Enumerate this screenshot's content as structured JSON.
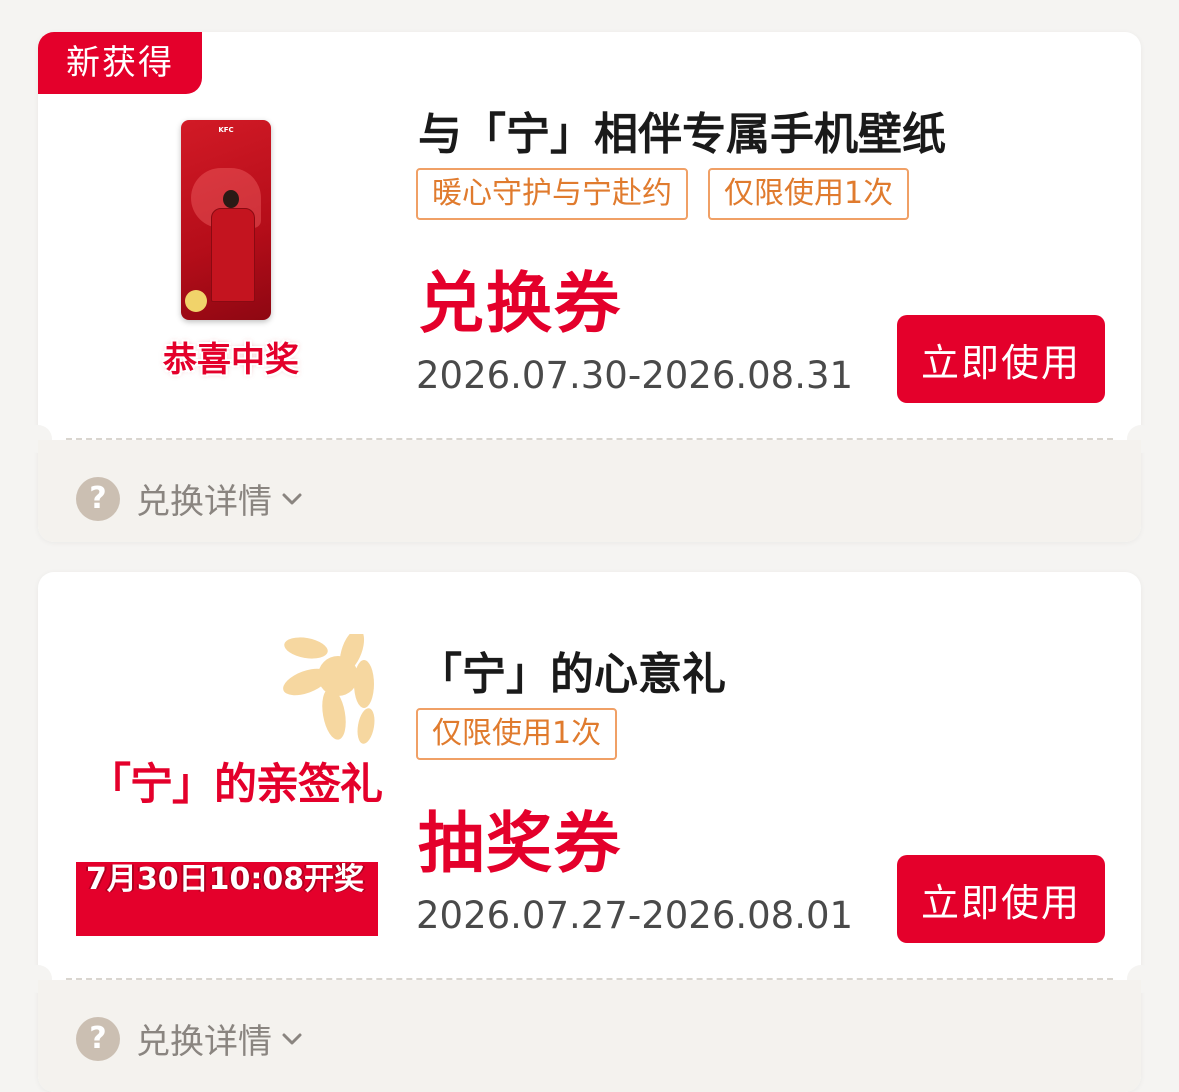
{
  "coupons": [
    {
      "badge": "新获得",
      "title": "与「宁」相伴专属手机壁纸",
      "tags": [
        "暖心守护与宁赴约",
        "仅限使用1次"
      ],
      "type": "兑换券",
      "date_range": "2026.07.30-2026.08.31",
      "use_button": "立即使用",
      "details_label": "兑换详情",
      "thumbnail": {
        "brand": "KFC",
        "caption": "恭喜中奖"
      }
    },
    {
      "title": "「宁」的心意礼",
      "tags": [
        "仅限使用1次"
      ],
      "type": "抽奖券",
      "date_range": "2026.07.27-2026.08.01",
      "use_button": "立即使用",
      "details_label": "兑换详情",
      "thumbnail": {
        "headline": "「宁」的亲签礼",
        "draw_time": "7月30日10:08开奖"
      }
    }
  ],
  "colors": {
    "accent": "#e4002b",
    "tag_border": "#f0a066",
    "tag_text": "#e07b2e",
    "page_bg": "#f5f4f2"
  },
  "icons": [
    "question-icon",
    "chevron-down-icon",
    "sunflower-icon"
  ]
}
